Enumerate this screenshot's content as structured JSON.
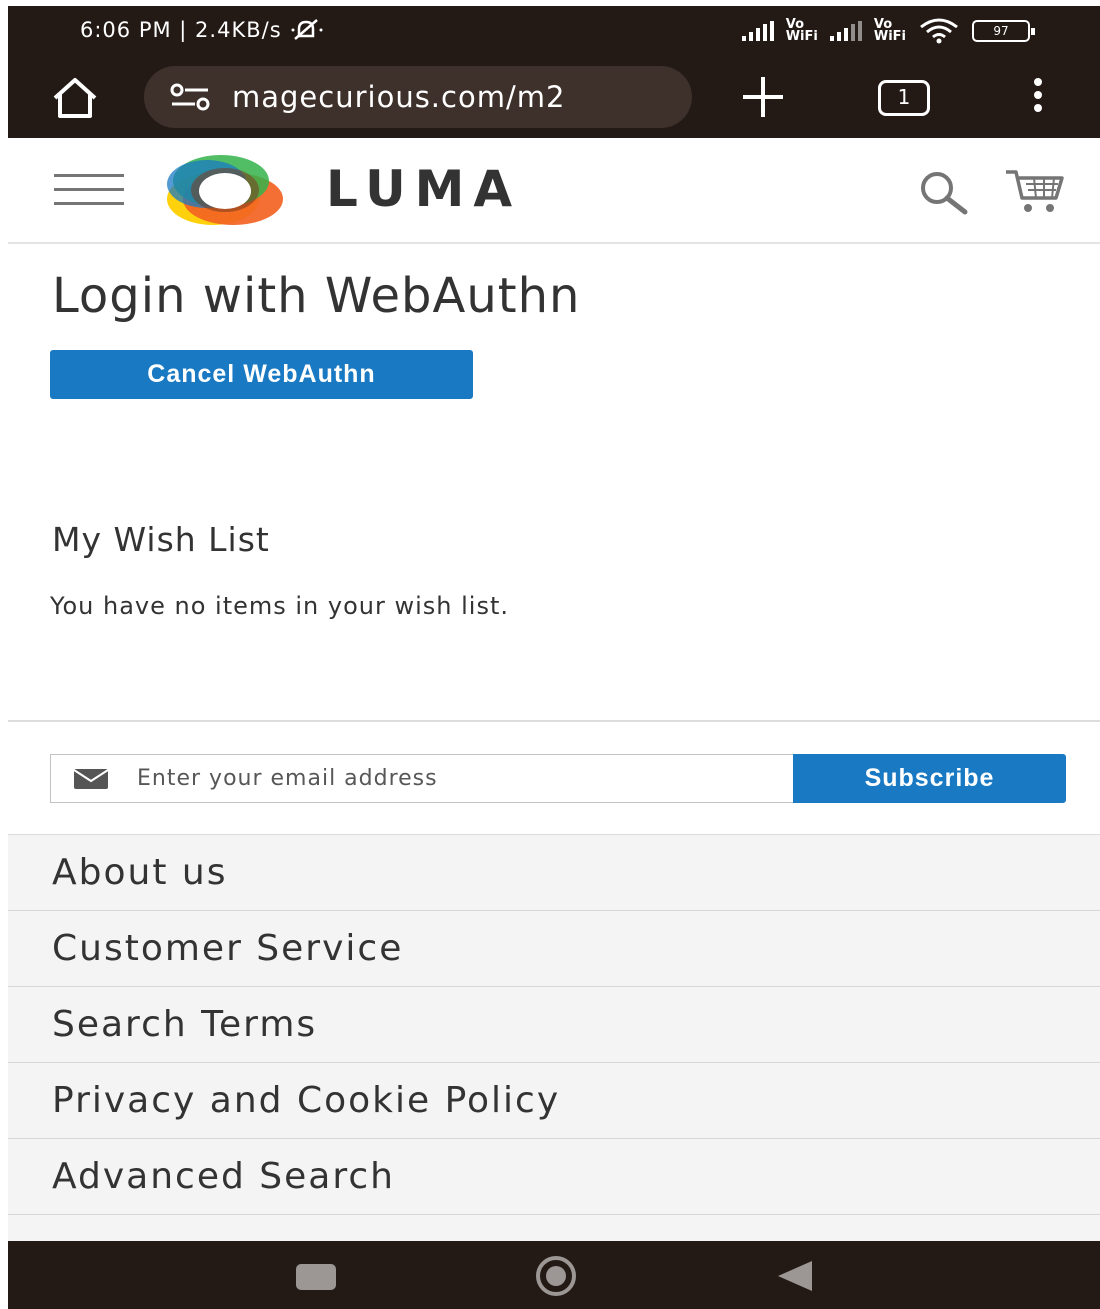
{
  "status_bar": {
    "time_speed": "6:06 PM | 2.4KB/s",
    "vowifi_top": "Vo",
    "vowifi_bottom": "WiFi",
    "battery": "97"
  },
  "browser": {
    "url": "magecurious.com/m2",
    "tab_count": "1"
  },
  "header": {
    "brand": "LUMA",
    "logo_colors": [
      "#f26322",
      "#ffcf00",
      "#32b34a",
      "#1979c3"
    ]
  },
  "main": {
    "page_title": "Login with WebAuthn",
    "cancel_label": "Cancel WebAuthn",
    "wishlist_title": "My Wish List",
    "wishlist_empty": "You have no items in your wish list."
  },
  "newsletter": {
    "placeholder": "Enter your email address",
    "subscribe_label": "Subscribe"
  },
  "footer": {
    "links": [
      "About us",
      "Customer Service",
      "Search Terms",
      "Privacy and Cookie Policy",
      "Advanced Search"
    ]
  },
  "colors": {
    "primary": "#1979c3",
    "system_bar": "#231a16"
  }
}
